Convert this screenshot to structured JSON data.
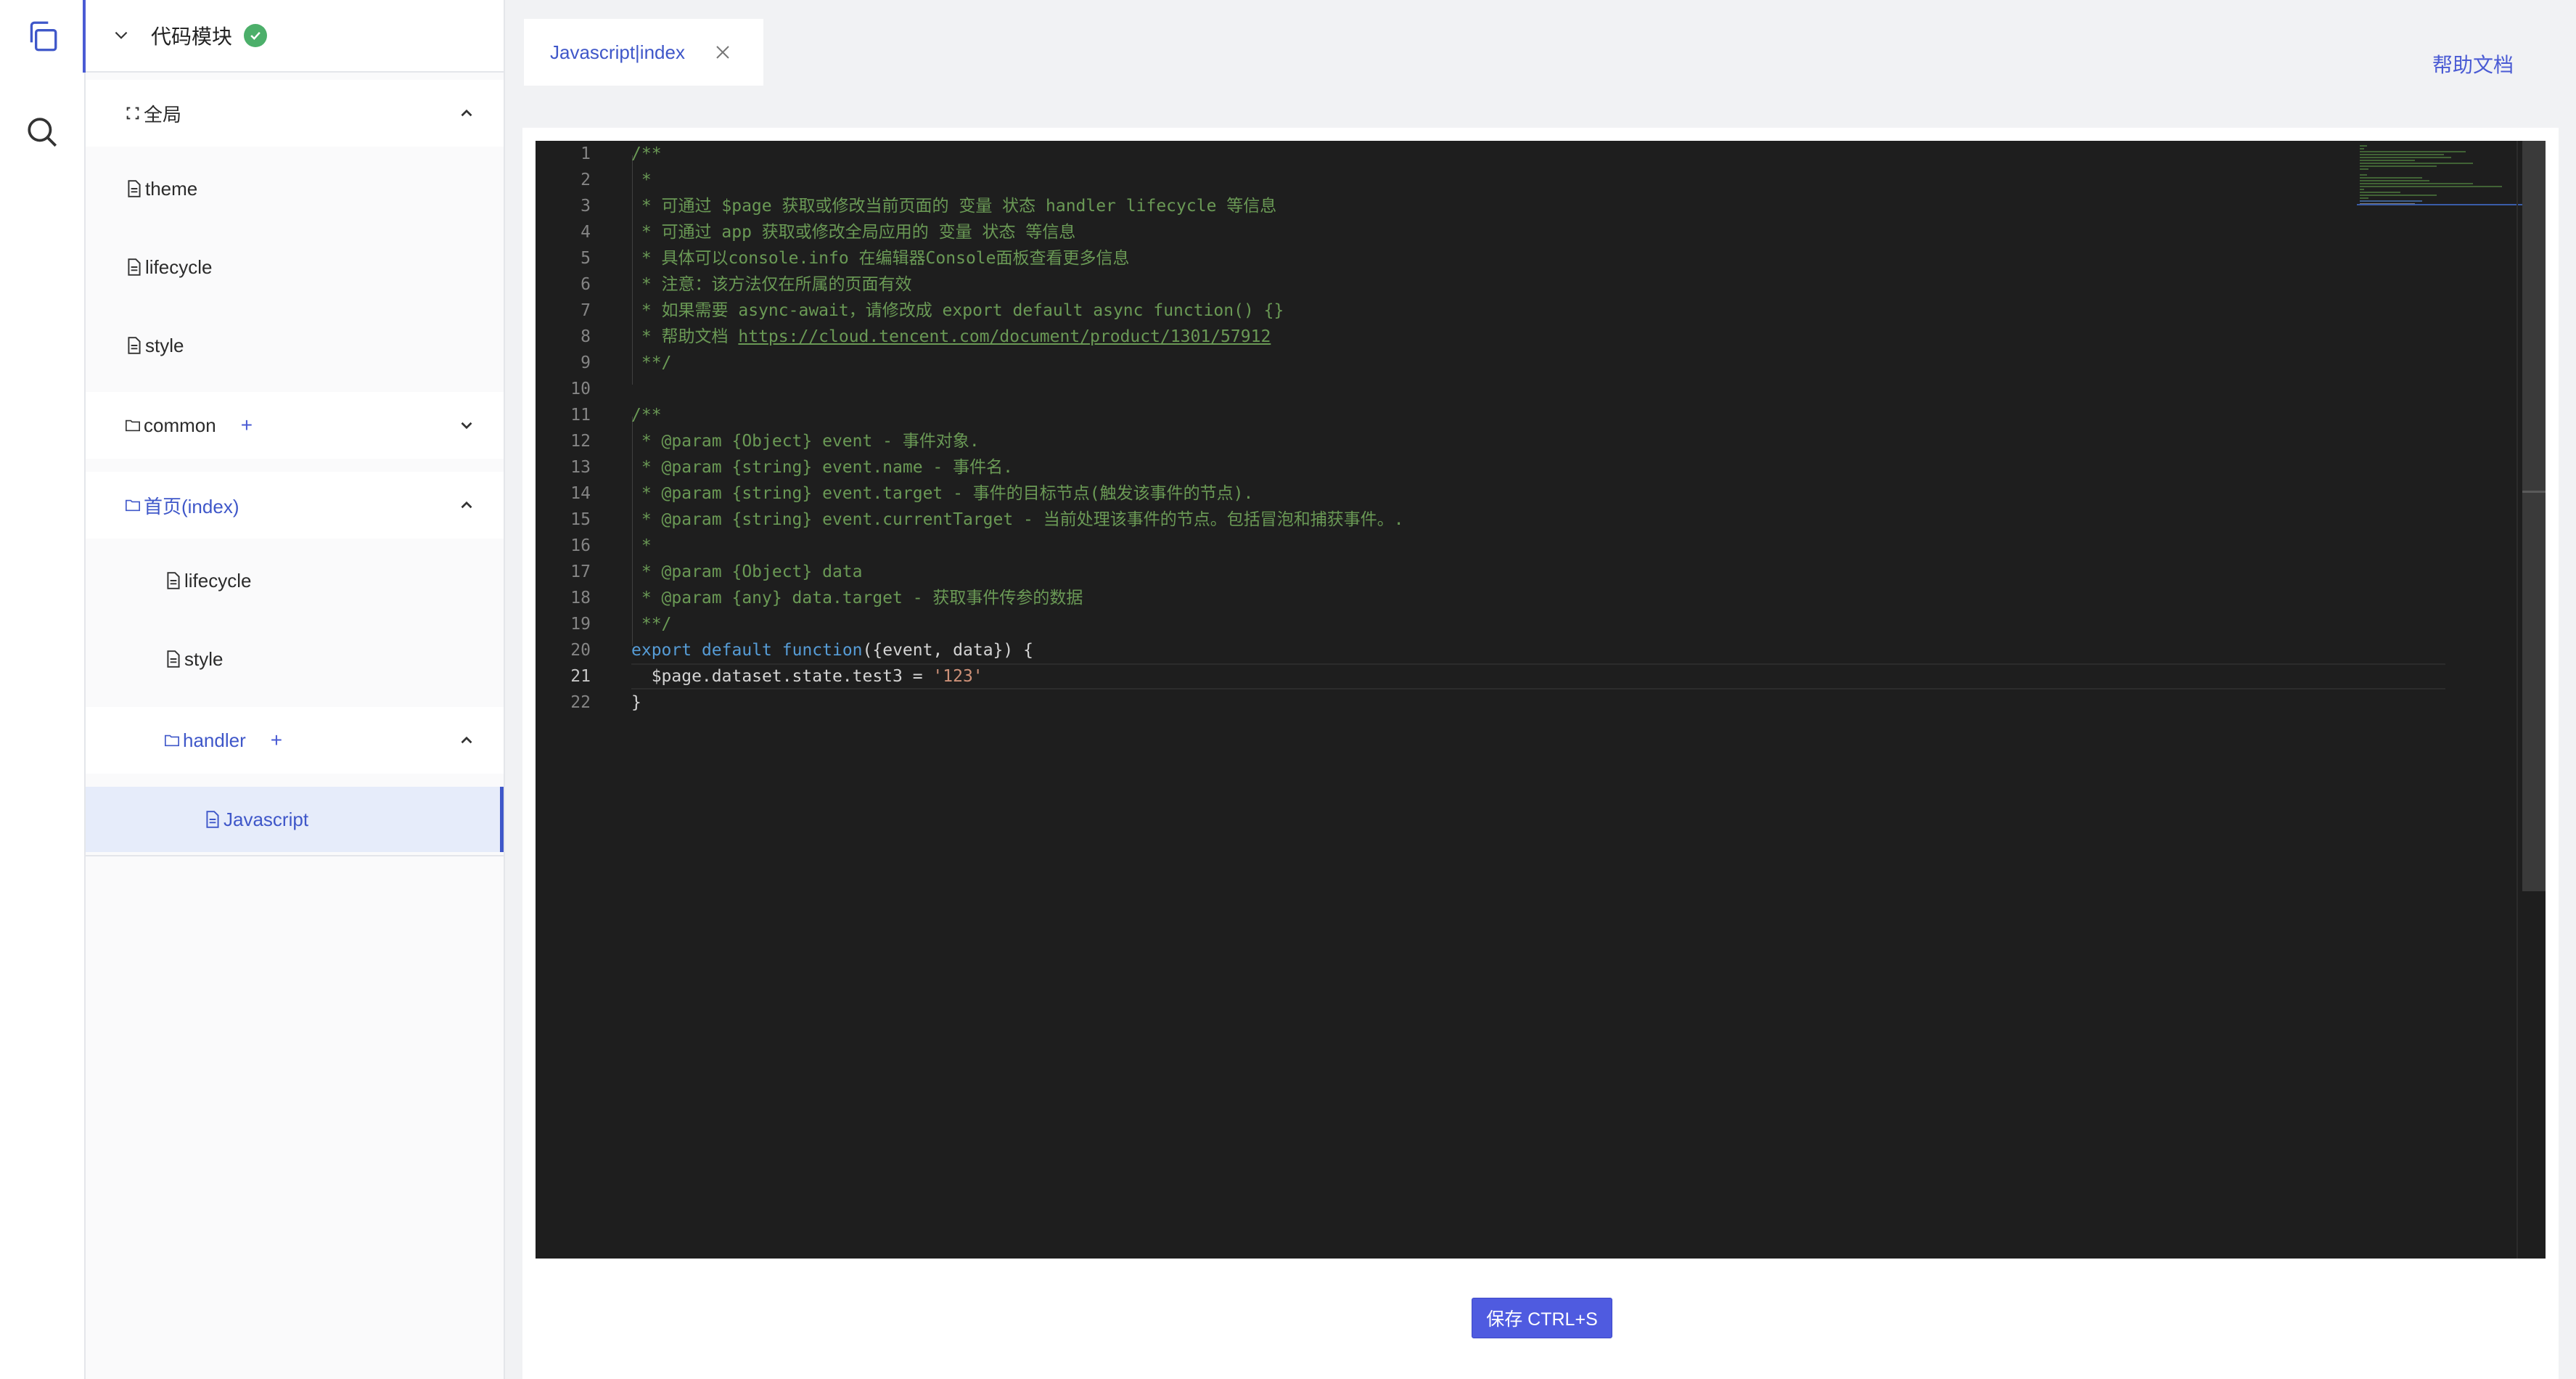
{
  "rail": {
    "items": [
      {
        "icon": "copy-pages-icon"
      },
      {
        "icon": "search-icon"
      }
    ]
  },
  "tree": {
    "header": {
      "label": "代码模块",
      "status_icon": "check-circle-icon"
    },
    "items": [
      {
        "label": "全局"
      },
      {
        "label": "theme"
      },
      {
        "label": "lifecycle"
      },
      {
        "label": "style"
      },
      {
        "label": "common",
        "add": "+"
      },
      {
        "label": "首页(index)"
      },
      {
        "label": "lifecycle"
      },
      {
        "label": "style"
      },
      {
        "label": "handler",
        "add": "+"
      },
      {
        "label": "Javascript"
      }
    ]
  },
  "tab": {
    "label": "Javascript|index",
    "close_icon": "close-icon"
  },
  "help": {
    "label": "帮助文档"
  },
  "editor": {
    "language": "javascript",
    "current_line": 21,
    "line_numbers": [
      "1",
      "2",
      "3",
      "4",
      "5",
      "6",
      "7",
      "8",
      "9",
      "10",
      "11",
      "12",
      "13",
      "14",
      "15",
      "16",
      "17",
      "18",
      "19",
      "20",
      "21",
      "22"
    ],
    "lines": [
      "/**",
      " *",
      " * 可通过 $page 获取或修改当前页面的 变量 状态 handler lifecycle 等信息",
      " * 可通过 app 获取或修改全局应用的 变量 状态 等信息",
      " * 具体可以console.info 在编辑器Console面板查看更多信息",
      " * 注意：该方法仅在所属的页面有效",
      " * 如果需要 async-await，请修改成 export default async function() {}",
      " * 帮助文档 ",
      " **/",
      "",
      "/**",
      " * @param {Object} event - 事件对象.",
      " * @param {string} event.name - 事件名.",
      " * @param {string} event.target - 事件的目标节点(触发该事件的节点).",
      " * @param {string} event.currentTarget - 当前处理该事件的节点。包括冒泡和捕获事件。.",
      " *",
      " * @param {Object} data",
      " * @param {any} data.target - 获取事件传参的数据",
      " **/",
      "",
      "  $page.dataset.state.test3 = ",
      "}"
    ],
    "line8_url": "https://cloud.tencent.com/document/product/1301/57912",
    "line20": {
      "kw1": "export",
      "kw2": "default",
      "kw3": "function",
      "rest": "({event, data}) {"
    },
    "line21_string": "'123'"
  },
  "save": {
    "label": "保存 CTRL+S"
  },
  "colors": {
    "accent": "#4a5bd4",
    "editor_bg": "#1e1e1e",
    "comment": "#6a9955",
    "keyword": "#569cd6",
    "string": "#ce9178",
    "success": "#4caf6a"
  }
}
